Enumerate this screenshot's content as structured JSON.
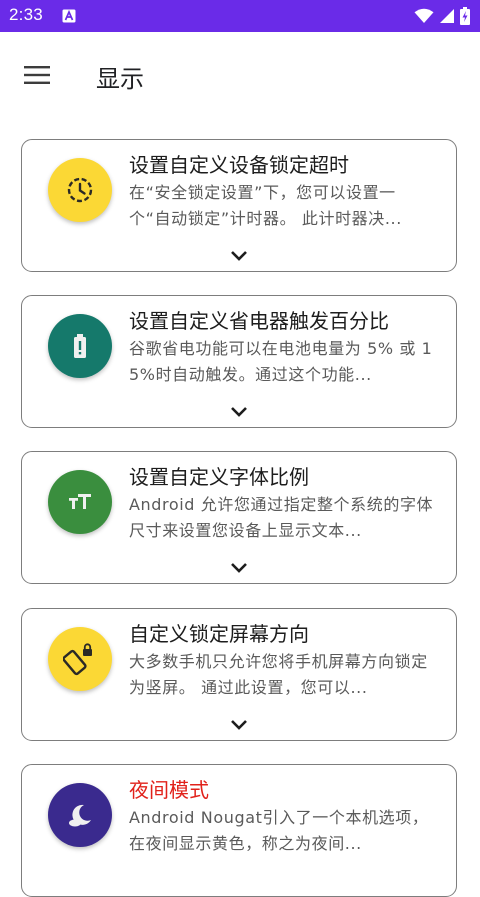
{
  "status_bar": {
    "time": "2:33",
    "background": "#6a2be8"
  },
  "app_bar": {
    "title": "显示"
  },
  "cards": [
    {
      "title": "设置自定义设备锁定超时",
      "description": "在“安全锁定设置”下，您可以设置一个“自动锁定”计时器。 此计时器决...",
      "icon": "lock-timer-icon",
      "icon_color": "#fbd835",
      "title_color": "#1d1d1d"
    },
    {
      "title": "设置自定义省电器触发百分比",
      "description": "谷歌省电功能可以在电池电量为 5% 或 15%时自动触发。通过这个功能...",
      "icon": "battery-alert-icon",
      "icon_color": "#15796b",
      "title_color": "#1d1d1d"
    },
    {
      "title": "设置自定义字体比例",
      "description": "Android 允许您通过指定整个系统的字体尺寸来设置您设备上显示文本...",
      "icon": "font-size-icon",
      "icon_color": "#3a8e3e",
      "title_color": "#1d1d1d"
    },
    {
      "title": "自定义锁定屏幕方向",
      "description": "大多数手机只允许您将手机屏幕方向锁定为竖屏。 通过此设置，您可以...",
      "icon": "screen-rotation-lock-icon",
      "icon_color": "#fbd835",
      "title_color": "#1d1d1d"
    },
    {
      "title": "夜间模式",
      "description": "Android Nougat引入了一个本机选项，在夜间显示黄色，称之为夜间...",
      "icon": "night-mode-icon",
      "icon_color": "#3a2a8e",
      "title_color": "#e1211a"
    }
  ]
}
